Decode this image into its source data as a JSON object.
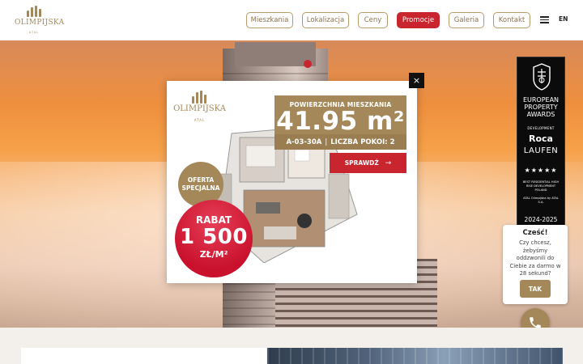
{
  "brand": {
    "name": "OLIMPIJSKA",
    "subtitle": "ATAL"
  },
  "nav": {
    "items": [
      {
        "label": "Mieszkania",
        "active": false
      },
      {
        "label": "Lokalizacja",
        "active": false
      },
      {
        "label": "Ceny",
        "active": false
      },
      {
        "label": "Promocje",
        "active": true
      },
      {
        "label": "Galeria",
        "active": false
      },
      {
        "label": "Kontakt",
        "active": false
      }
    ],
    "menu_icon": "hamburger-icon",
    "language": "EN"
  },
  "award": {
    "line1": "EUROPEAN",
    "line2": "PROPERTY",
    "line3": "AWARDS",
    "line4": "DEVELOPMENT",
    "sponsor1": "Roca",
    "sponsor2": "LAUFEN",
    "stars": "★★★★★",
    "category": "BEST RESIDENTIAL HIGH RISE DEVELOPMENT POLAND",
    "winner": "ATAL Olimpijska by ATAL S.A.",
    "year": "2024-2025"
  },
  "modal": {
    "close_label": "×",
    "logo_name": "OLIMPIJSKA",
    "logo_sub": "ATAL",
    "area_label": "POWIERZCHNIA MIESZKANIA",
    "area_value": "41.95 m²",
    "unit_code": "A-03-30A",
    "rooms_text": "LICZBA POKOI:",
    "rooms_value": "2",
    "check_label": "SPRAWDŹ",
    "offer_badge": "OFERTA SPECJALNA",
    "discount_line1": "RABAT",
    "discount_line2": "1 500",
    "discount_line3": "ZŁ/M²"
  },
  "chat": {
    "title": "Cześć!",
    "message": "Czy chcesz, żebyśmy oddzwonili do Ciebie za darmo w 28 sekund?",
    "button": "TAK",
    "phone_icon": "phone-icon"
  },
  "colors": {
    "gold": "#a4885a",
    "red": "#c9252e",
    "dark": "#111111"
  }
}
